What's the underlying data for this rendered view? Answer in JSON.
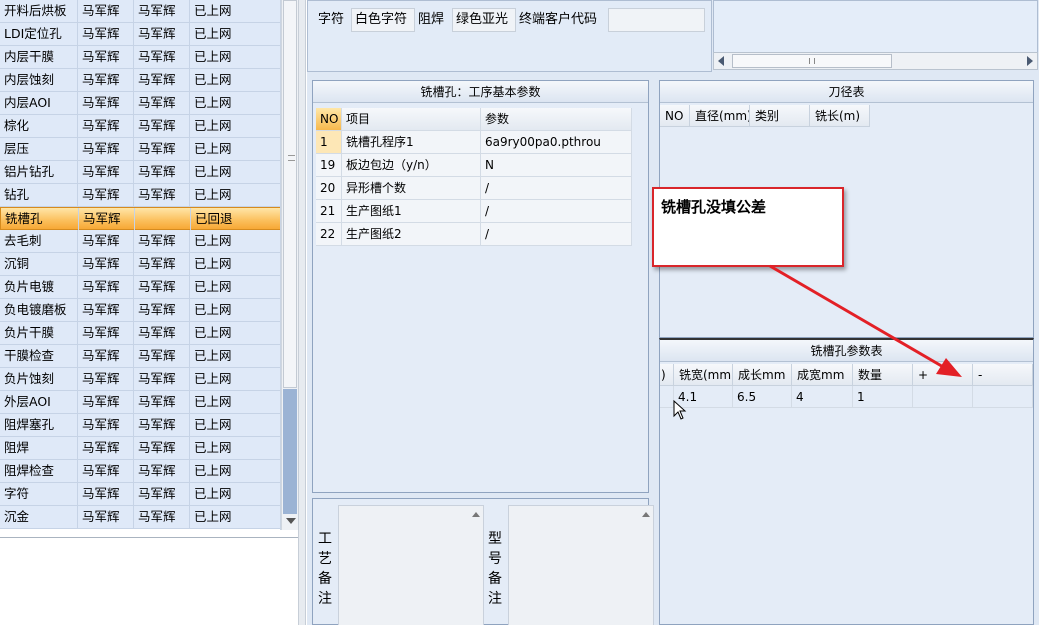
{
  "process_list": {
    "rows": [
      {
        "name": "开料后烘板",
        "c1": "马军辉",
        "c2": "马军辉",
        "status": "已上网"
      },
      {
        "name": "LDI定位孔",
        "c1": "马军辉",
        "c2": "马军辉",
        "status": "已上网"
      },
      {
        "name": "内层干膜",
        "c1": "马军辉",
        "c2": "马军辉",
        "status": "已上网"
      },
      {
        "name": "内层蚀刻",
        "c1": "马军辉",
        "c2": "马军辉",
        "status": "已上网"
      },
      {
        "name": "内层AOI",
        "c1": "马军辉",
        "c2": "马军辉",
        "status": "已上网"
      },
      {
        "name": "棕化",
        "c1": "马军辉",
        "c2": "马军辉",
        "status": "已上网"
      },
      {
        "name": "层压",
        "c1": "马军辉",
        "c2": "马军辉",
        "status": "已上网"
      },
      {
        "name": "铝片钻孔",
        "c1": "马军辉",
        "c2": "马军辉",
        "status": "已上网"
      },
      {
        "name": "钻孔",
        "c1": "马军辉",
        "c2": "马军辉",
        "status": "已上网"
      },
      {
        "name": "铣槽孔",
        "c1": "马军辉",
        "c2": "",
        "status": "已回退"
      },
      {
        "name": "去毛刺",
        "c1": "马军辉",
        "c2": "马军辉",
        "status": "已上网"
      },
      {
        "name": "沉铜",
        "c1": "马军辉",
        "c2": "马军辉",
        "status": "已上网"
      },
      {
        "name": "负片电镀",
        "c1": "马军辉",
        "c2": "马军辉",
        "status": "已上网"
      },
      {
        "name": "负电镀磨板",
        "c1": "马军辉",
        "c2": "马军辉",
        "status": "已上网"
      },
      {
        "name": "负片干膜",
        "c1": "马军辉",
        "c2": "马军辉",
        "status": "已上网"
      },
      {
        "name": "干膜检查",
        "c1": "马军辉",
        "c2": "马军辉",
        "status": "已上网"
      },
      {
        "name": "负片蚀刻",
        "c1": "马军辉",
        "c2": "马军辉",
        "status": "已上网"
      },
      {
        "name": "外层AOI",
        "c1": "马军辉",
        "c2": "马军辉",
        "status": "已上网"
      },
      {
        "name": "阻焊塞孔",
        "c1": "马军辉",
        "c2": "马军辉",
        "status": "已上网"
      },
      {
        "name": "阻焊",
        "c1": "马军辉",
        "c2": "马军辉",
        "status": "已上网"
      },
      {
        "name": "阻焊检查",
        "c1": "马军辉",
        "c2": "马军辉",
        "status": "已上网"
      },
      {
        "name": "字符",
        "c1": "马军辉",
        "c2": "马军辉",
        "status": "已上网"
      },
      {
        "name": "沉金",
        "c1": "马军辉",
        "c2": "马军辉",
        "status": "已上网"
      }
    ],
    "selected_index": 9
  },
  "top_info": {
    "char_label": "字符",
    "char_value": "白色字符",
    "mask_label": "阻焊",
    "mask_value": "绿色亚光",
    "customer_code_label": "终端客户代码",
    "customer_code_value": ""
  },
  "params_panel": {
    "title": "铣槽孔：工序基本参数",
    "headers": [
      "NO",
      "项目",
      "参数"
    ],
    "rows": [
      {
        "no": "1",
        "item": "铣槽孔程序1",
        "value": "6a9ry00pa0.pthrou"
      },
      {
        "no": "19",
        "item": "板边包边（y/n）",
        "value": "N"
      },
      {
        "no": "20",
        "item": "异形槽个数",
        "value": "/"
      },
      {
        "no": "21",
        "item": "生产图纸1",
        "value": "/"
      },
      {
        "no": "22",
        "item": "生产图纸2",
        "value": "/"
      }
    ]
  },
  "tool_panel": {
    "title": "刀径表",
    "headers": [
      "NO",
      "直径(mm)",
      "类别",
      "铣长(m)"
    ]
  },
  "slot_panel": {
    "title": "铣槽孔参数表",
    "headers": [
      ")",
      "铣宽(mm)",
      "成长mm",
      "成宽mm",
      "数量",
      "+",
      "-"
    ],
    "rows": [
      {
        "c0": "",
        "width": "4.1",
        "length": "6.5",
        "fwidth": "4",
        "qty": "1",
        "plus": "",
        "minus": ""
      }
    ]
  },
  "remarks": {
    "process_label": "工艺备注",
    "model_label": "型号备注"
  },
  "annotation": {
    "text": "铣槽孔没填公差",
    "color": "#d9262b"
  }
}
